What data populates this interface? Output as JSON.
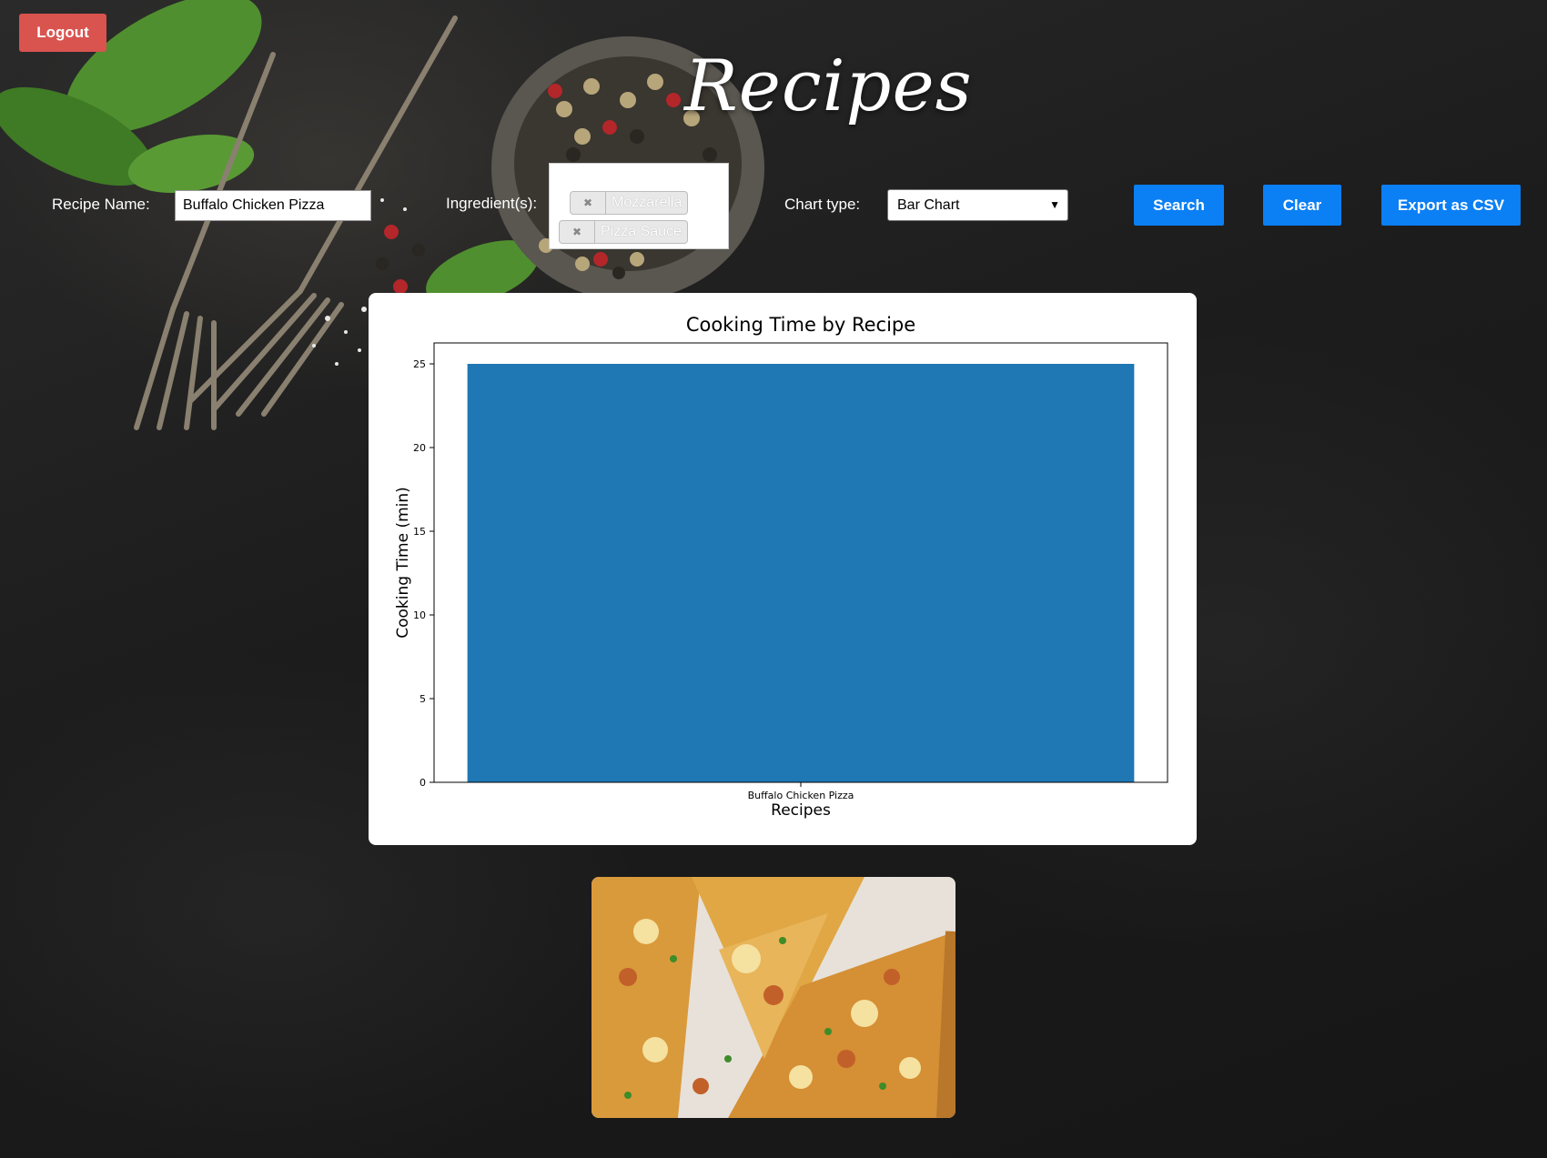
{
  "header": {
    "logout_label": "Logout",
    "title": "Recipes"
  },
  "search": {
    "recipe_name_label": "Recipe Name:",
    "recipe_name_value": "Buffalo Chicken Pizza",
    "ingredients_label": "Ingredient(s):",
    "ingredients": [
      "Mozzarella",
      "Pizza Sauce"
    ],
    "chart_type_label": "Chart type:",
    "chart_type_value": "Bar Chart",
    "search_label": "Search",
    "clear_label": "Clear",
    "export_label": "Export as CSV"
  },
  "colors": {
    "logout": "#d9534f",
    "primary_button": "#0b7ff4",
    "bar": "#1f77b4"
  },
  "icons": {
    "tag_remove": "close-icon",
    "select_arrow": "chevron-down-icon"
  },
  "chart_data": {
    "type": "bar",
    "title": "Cooking Time by Recipe",
    "xlabel": "Recipes",
    "ylabel": "Cooking Time (min)",
    "categories": [
      "Buffalo Chicken Pizza"
    ],
    "values": [
      25
    ],
    "ylim": [
      0,
      26.25
    ],
    "yticks": [
      0,
      5,
      10,
      15,
      20,
      25
    ],
    "grid": false
  }
}
